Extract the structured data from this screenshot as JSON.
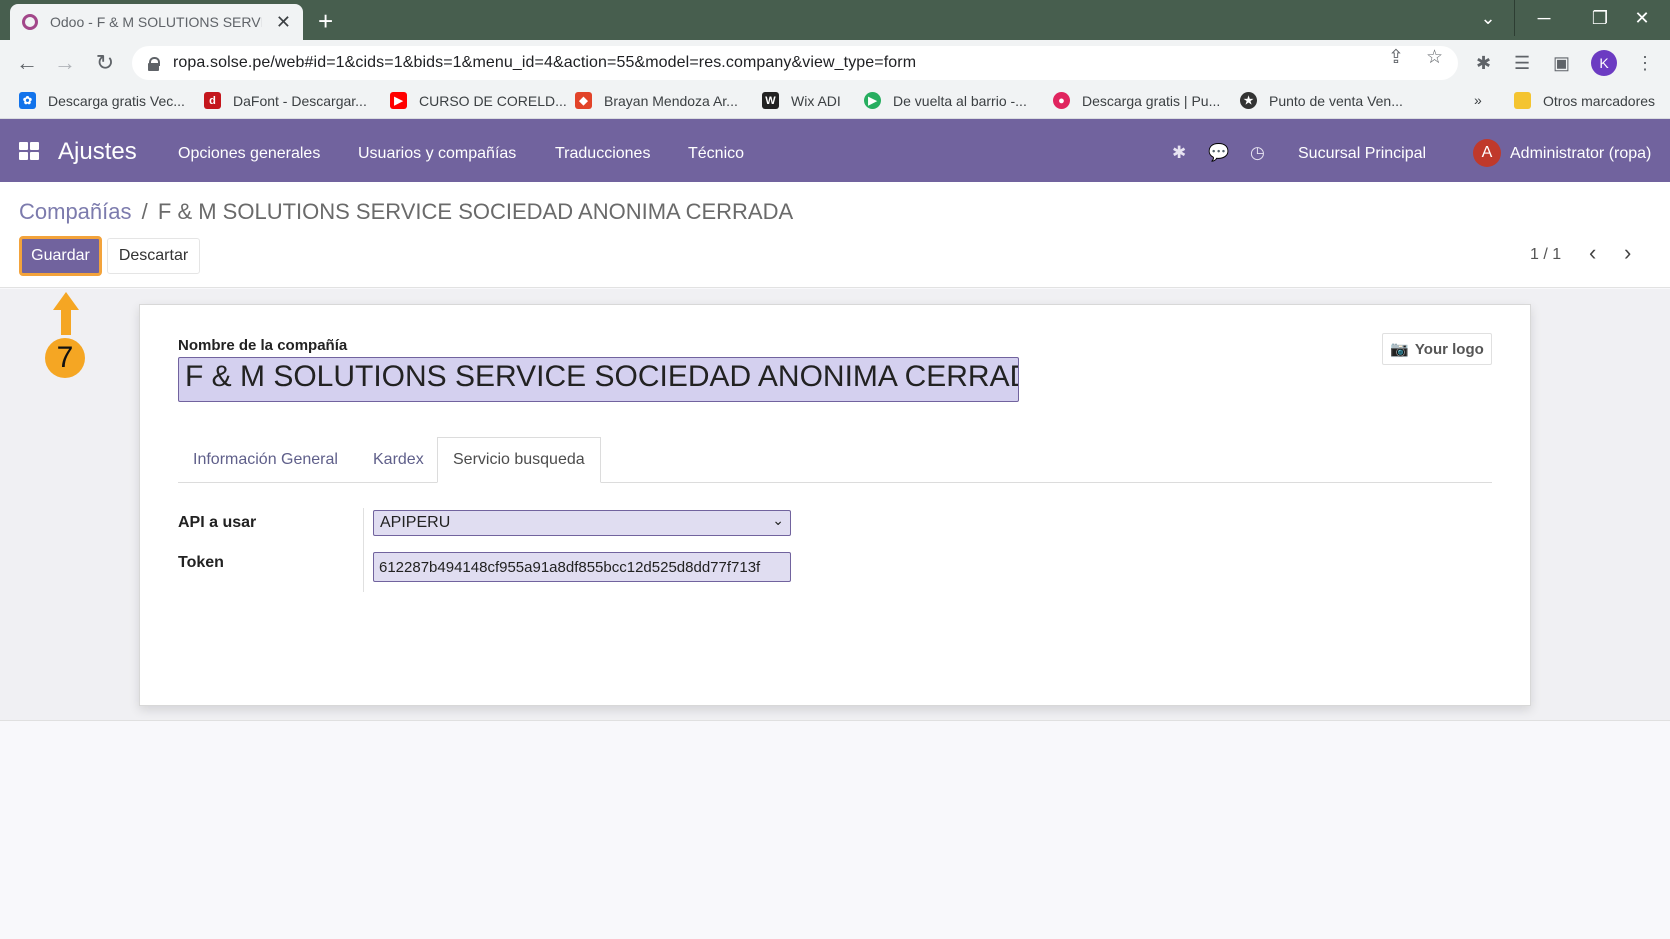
{
  "browser": {
    "tab_title": "Odoo - F & M SOLUTIONS SERVICE SOCIEDAD ANONIMA CERRADA",
    "url": "ropa.solse.pe/web#id=1&cids=1&bids=1&menu_id=4&action=55&model=res.company&view_type=form",
    "profile_initial": "K",
    "bookmarks": [
      {
        "label": "Descarga gratis Vec...",
        "icon": "freepik-icon",
        "color": "#1273eb"
      },
      {
        "label": "DaFont - Descargar...",
        "icon": "dafont-icon",
        "color": "#c4161c"
      },
      {
        "label": "CURSO DE CORELD...",
        "icon": "youtube-icon",
        "color": "#ff0000"
      },
      {
        "label": "Brayan Mendoza Ar...",
        "icon": "gitlab-icon",
        "color": "#e24329"
      },
      {
        "label": "Wix ADI",
        "icon": "wix-icon",
        "color": "#222222"
      },
      {
        "label": "De vuelta al barrio -...",
        "icon": "play-icon",
        "color": "#27ae60"
      },
      {
        "label": "Descarga gratis | Pu...",
        "icon": "drop-icon",
        "color": "#e0245e"
      },
      {
        "label": "Punto de venta Ven...",
        "icon": "star-badge-icon",
        "color": "#333333"
      }
    ],
    "bookmarks_overflow": "»",
    "other_bookmarks": "Otros marcadores"
  },
  "navbar": {
    "app_name": "Ajustes",
    "menu": [
      "Opciones generales",
      "Usuarios y compañías",
      "Traducciones",
      "Técnico"
    ],
    "company": "Sucursal Principal",
    "user_initial": "A",
    "user_name": "Administrator (ropa)",
    "accent": "#71639e"
  },
  "control_panel": {
    "breadcrumb_parent": "Compañías",
    "breadcrumb_separator": "/",
    "breadcrumb_current": "F & M SOLUTIONS SERVICE SOCIEDAD ANONIMA CERRADA",
    "save_label": "Guardar",
    "discard_label": "Descartar",
    "pager": "1 / 1"
  },
  "annotation": {
    "step_number": "7",
    "color": "#f5a623"
  },
  "form": {
    "company_label": "Nombre de la compañía",
    "company_name": "F & M SOLUTIONS SERVICE SOCIEDAD ANONIMA CERRADA",
    "logo_label": "Your logo",
    "tabs": [
      "Información General",
      "Kardex",
      "Servicio busqueda"
    ],
    "active_tab": "Servicio busqueda",
    "api_label": "API a usar",
    "api_value": "APIPERU",
    "token_label": "Token",
    "token_value": "612287b494148cf955a91a8df855bcc12d525d8dd77f713f"
  }
}
